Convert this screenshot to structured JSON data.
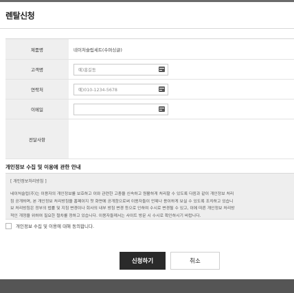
{
  "modal": {
    "title": "렌탈신청"
  },
  "form": {
    "product": {
      "label": "제품명",
      "value": "네이처슬립세트(수퍼싱글)"
    },
    "customer": {
      "label": "고객명",
      "placeholder": "예)홍길동",
      "icon": "keyboard-icon"
    },
    "phone": {
      "label": "연락처",
      "placeholder": "예)010-1234-5678",
      "icon": "keyboard-icon"
    },
    "email": {
      "label": "이메일",
      "placeholder": "",
      "icon": "keyboard-icon"
    },
    "message": {
      "label": "전달사항",
      "value": ""
    }
  },
  "privacy": {
    "title": "개인정보 수집 및 이용에 관한 안내",
    "heading": "[ 개인정보처리방침 ]",
    "lines": [
      "네이처슬립(주)는 이용자의 개인정보를 보호하고 이와 관련한 고충을 신속하고 원활하게 처리할 수 있도록 다음과 같이 개인정보 처리",
      "침 공개하며, 본 개인정보 처리방침을 홈페이지 첫 화면에 공개함으로써 이용자들이 언제나 용이하게 보실 수 있도록 조치하고 있습니",
      "보 처리방침은 정부의 법률 및 지침 변경이나 회사의 내부 방침 변경 등으로 인하여 수시로 변경될 수 있고, 이에 따른 개인정보 처리방",
      "적인 개정을 위하여 필요한 절차를 정하고 있습니다. 이용자들께서는 사이트 방문 시 수시로 확인하시기 바랍니다."
    ]
  },
  "agree": {
    "label": "개인정보 수집 및 이용에 대해 동의합니다.",
    "checked": false
  },
  "buttons": {
    "apply": "신청하기",
    "cancel": "취소"
  }
}
